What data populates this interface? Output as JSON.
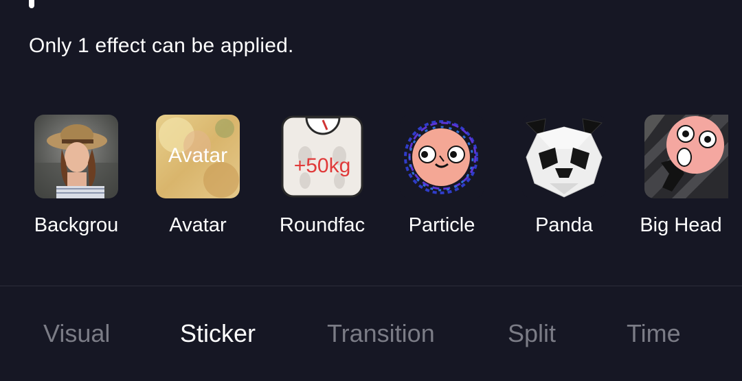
{
  "panel": {
    "info_text": "Only 1 effect can be applied."
  },
  "effects": [
    {
      "label": "Backgrou",
      "icon": "background-effect-icon"
    },
    {
      "label": "Avatar",
      "icon": "avatar-effect-icon",
      "thumb_text": "Avatar"
    },
    {
      "label": "Roundfac",
      "icon": "roundface-scale-icon",
      "thumb_text": "+50kg"
    },
    {
      "label": "Particle",
      "icon": "particle-face-icon"
    },
    {
      "label": "Panda",
      "icon": "panda-icon"
    },
    {
      "label": "Big Head",
      "icon": "big-head-icon"
    }
  ],
  "tabs": [
    {
      "label": "Visual",
      "active": false
    },
    {
      "label": "Sticker",
      "active": true
    },
    {
      "label": "Transition",
      "active": false
    },
    {
      "label": "Split",
      "active": false
    },
    {
      "label": "Time",
      "active": false
    }
  ],
  "colors": {
    "background": "#161724",
    "text": "#ffffff",
    "inactive_tab": "#7b7c86"
  }
}
